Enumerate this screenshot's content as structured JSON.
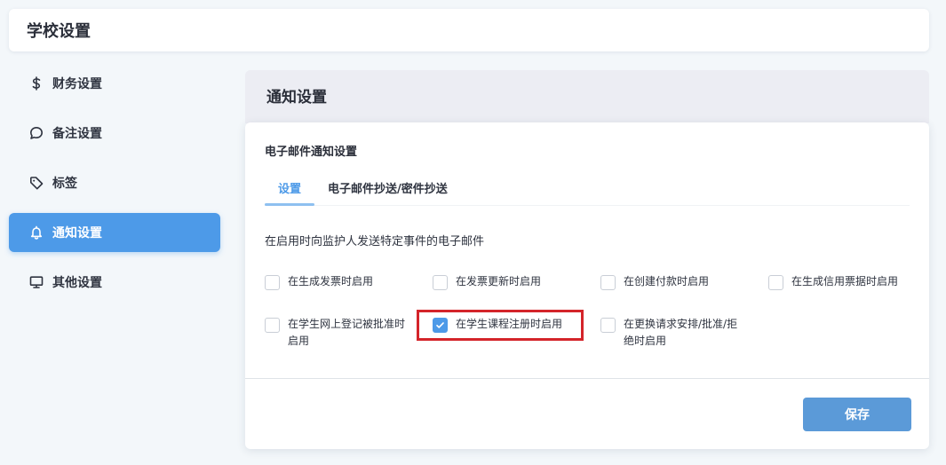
{
  "header": {
    "title": "学校设置"
  },
  "sidebar": {
    "items": [
      {
        "label": "财务设置",
        "icon": "dollar-icon",
        "active": false
      },
      {
        "label": "备注设置",
        "icon": "speech-bubble-icon",
        "active": false
      },
      {
        "label": "标签",
        "icon": "tag-icon",
        "active": false
      },
      {
        "label": "通知设置",
        "icon": "bell-icon",
        "active": true
      },
      {
        "label": "其他设置",
        "icon": "monitor-icon",
        "active": false
      }
    ]
  },
  "panel": {
    "title": "通知设置",
    "section_title": "电子邮件通知设置",
    "tabs": [
      {
        "label": "设置",
        "active": true
      },
      {
        "label": "电子邮件抄送/密件抄送",
        "active": false
      }
    ],
    "description": "在启用时向监护人发送特定事件的电子邮件",
    "options": [
      {
        "label": "在生成发票时启用",
        "checked": false
      },
      {
        "label": "在发票更新时启用",
        "checked": false
      },
      {
        "label": "在创建付款时启用",
        "checked": false
      },
      {
        "label": "在生成信用票据时启用",
        "checked": false
      },
      {
        "label": "在学生网上登记被批准时启用",
        "checked": false
      },
      {
        "label": "在学生课程注册时启用",
        "checked": true
      },
      {
        "label": "在更换请求安排/批准/拒绝时启用",
        "checked": false
      }
    ],
    "save_label": "保存"
  },
  "colors": {
    "accent": "#4d9ae8",
    "save_button": "#5b9ad8",
    "highlight_box": "#d4242a"
  }
}
